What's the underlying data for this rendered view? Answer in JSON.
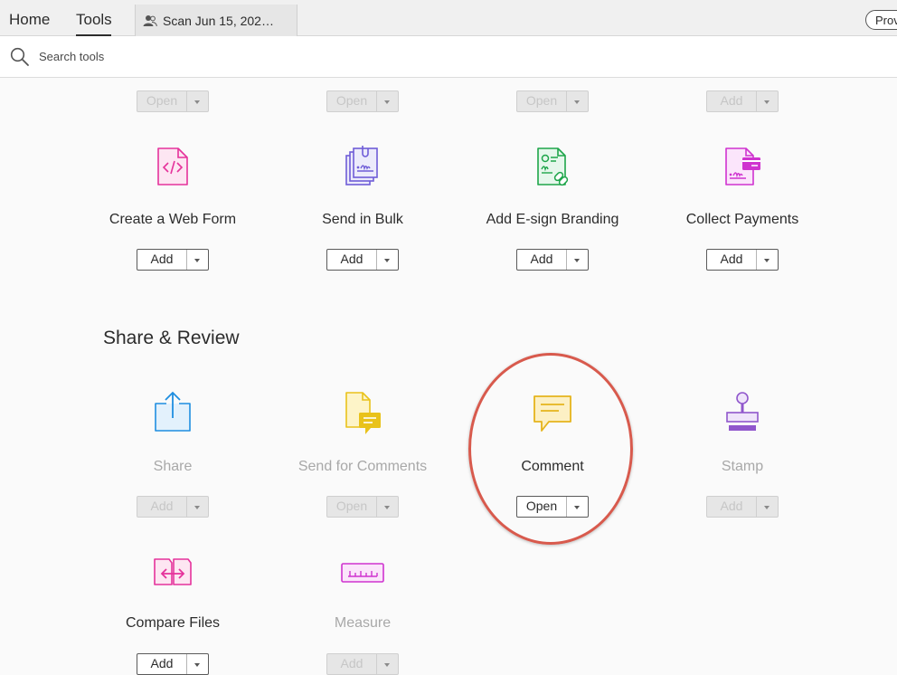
{
  "tabs": {
    "home": "Home",
    "tools": "Tools"
  },
  "document_tab": {
    "label": "Scan Jun 15, 202…"
  },
  "header": {
    "right_button_label": "Prov"
  },
  "search": {
    "placeholder": "Search tools"
  },
  "top_row_buttons": [
    {
      "label": "Open",
      "state": "disabled"
    },
    {
      "label": "Open",
      "state": "disabled"
    },
    {
      "label": "Open",
      "state": "disabled"
    },
    {
      "label": "Add",
      "state": "disabled"
    }
  ],
  "forms_row": [
    {
      "name": "Create a Web Form",
      "button": "Add",
      "icon": "web-form-icon",
      "color": "#e5329b"
    },
    {
      "name": "Send in Bulk",
      "button": "Add",
      "icon": "send-bulk-icon",
      "color": "#6f5dd8"
    },
    {
      "name": "Add E-sign Branding",
      "button": "Add",
      "icon": "esign-branding-icon",
      "color": "#1ea54a"
    },
    {
      "name": "Collect Payments",
      "button": "Add",
      "icon": "collect-payments-icon",
      "color": "#cf33cf"
    }
  ],
  "share_review": {
    "title": "Share & Review",
    "tools": [
      {
        "name": "Share",
        "button": "Add",
        "enabled": false,
        "icon": "share-icon",
        "color": "#1e8ee0"
      },
      {
        "name": "Send for Comments",
        "button": "Open",
        "enabled": false,
        "icon": "send-for-comments-icon",
        "color": "#e9c21a"
      },
      {
        "name": "Comment",
        "button": "Open",
        "enabled": true,
        "icon": "comment-icon",
        "color": "#e5b41c"
      },
      {
        "name": "Stamp",
        "button": "Add",
        "enabled": false,
        "icon": "stamp-icon",
        "color": "#9057cc"
      }
    ]
  },
  "bottom_row": [
    {
      "name": "Compare Files",
      "button": "Add",
      "enabled": true,
      "icon": "compare-files-icon",
      "color": "#e5329b"
    },
    {
      "name": "Measure",
      "button": "Add",
      "enabled": false,
      "icon": "measure-icon",
      "color": "#cf33cf"
    }
  ],
  "highlight": {
    "color": "#d85a4d"
  }
}
